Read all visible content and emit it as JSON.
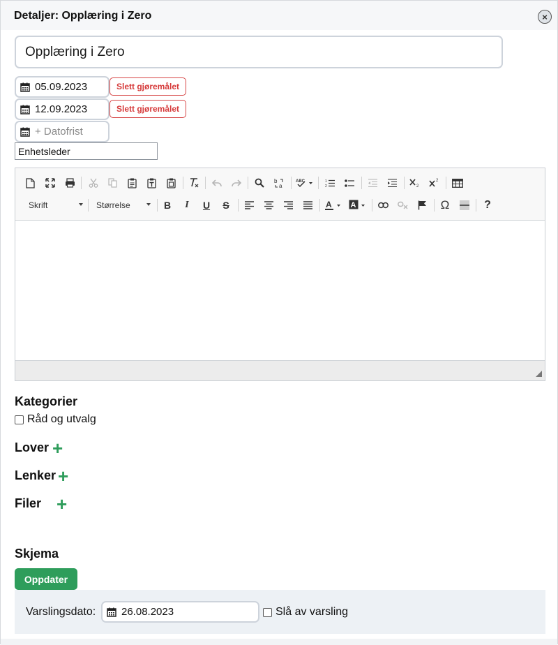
{
  "dialog": {
    "title": "Detaljer: Opplæring i Zero",
    "close_icon": "close-icon"
  },
  "task_title": {
    "value": "Opplæring i Zero"
  },
  "dates": [
    {
      "value": "05.09.2023",
      "delete_label": "Slett gjøremålet"
    },
    {
      "value": "12.09.2023",
      "delete_label": "Slett gjøremålet"
    }
  ],
  "deadline": {
    "placeholder": "+ Datofrist"
  },
  "role": {
    "value": "Enhetsleder"
  },
  "editor": {
    "font_combo": "Skrift",
    "size_combo": "Størrelse",
    "content": ""
  },
  "categories": {
    "heading": "Kategorier",
    "items": [
      {
        "label": "Råd og utvalg",
        "checked": false
      }
    ]
  },
  "laws": {
    "heading": "Lover"
  },
  "links": {
    "heading": "Lenker"
  },
  "files": {
    "heading": "Filer"
  },
  "schema": {
    "heading": "Skjema",
    "update_label": "Oppdater"
  },
  "notification": {
    "label": "Varslingsdato:",
    "date": "26.08.2023",
    "disable_label": "Slå av varsling",
    "disable_checked": false
  },
  "colors": {
    "accent": "#2e9d5b",
    "danger": "#d63a3a",
    "panel": "#edf1f5"
  }
}
